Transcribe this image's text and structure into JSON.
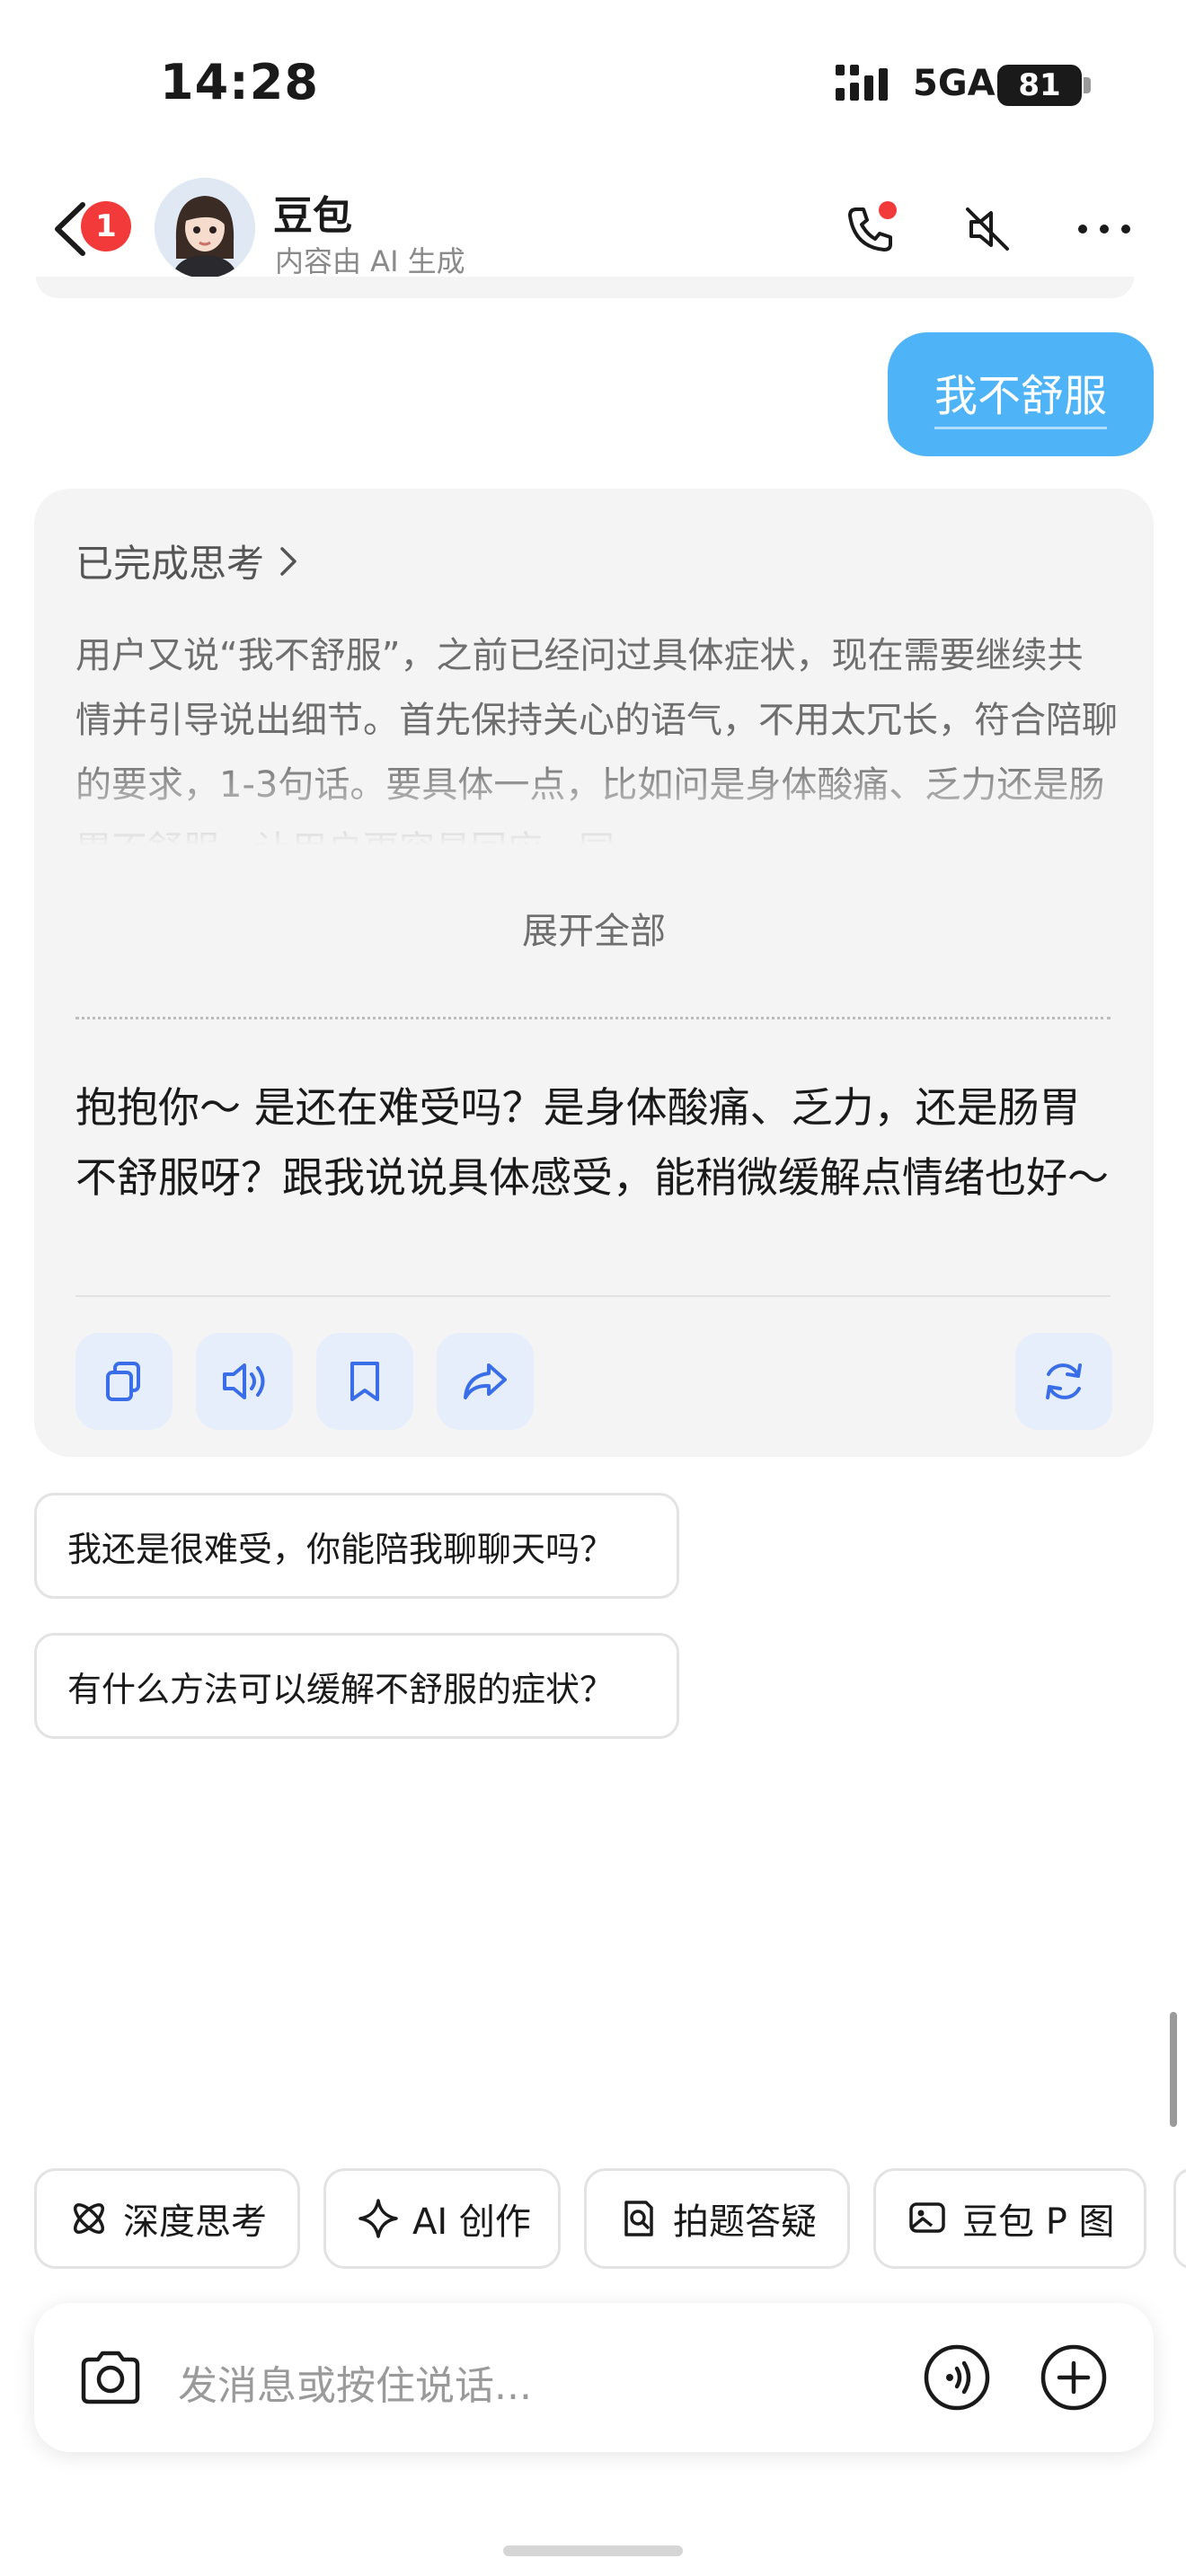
{
  "status_bar": {
    "time": "14:28",
    "network": "5GA",
    "battery": "81"
  },
  "header": {
    "back_badge": "1",
    "name": "豆包",
    "subtitle": "内容由 AI 生成"
  },
  "messages": {
    "user": "我不舒服",
    "ai": {
      "thinking_title": "已完成思考",
      "thinking_text": "用户又说“我不舒服”，之前已经问过具体症状，现在需要继续共情并引导说出细节。首先保持关心的语气，不用太冗长，符合陪聊的要求，1-3句话。要具体一点，比如问是身体酸痛、乏力还是肠胃不舒服，让用户更容易回应，同",
      "expand_label": "展开全部",
      "answer": "抱抱你～ 是还在难受吗？是身体酸痛、乏力，还是肠胃不舒服呀？跟我说说具体感受，能稍微缓解点情绪也好～"
    }
  },
  "suggestions": [
    "我还是很难受，你能陪我聊聊天吗？",
    "有什么方法可以缓解不舒服的症状？"
  ],
  "tools": [
    {
      "label": "深度思考",
      "icon": "atom-icon"
    },
    {
      "label": "AI 创作",
      "icon": "sparkle-icon"
    },
    {
      "label": "拍题答疑",
      "icon": "scan-doc-icon"
    },
    {
      "label": "豆包 P 图",
      "icon": "image-edit-icon"
    }
  ],
  "input": {
    "placeholder": "发消息或按住说话..."
  },
  "colors": {
    "accent": "#4fb3f7",
    "badge": "#f23a3a",
    "action_icon": "#3a6ee8"
  }
}
